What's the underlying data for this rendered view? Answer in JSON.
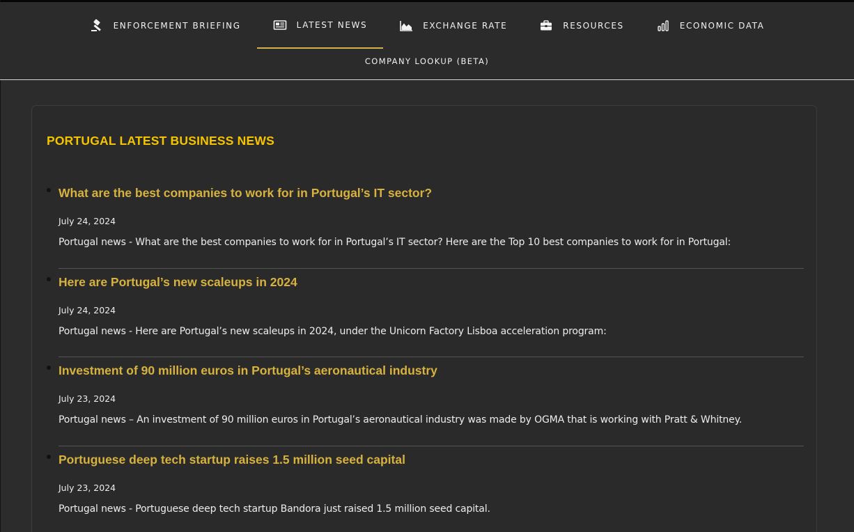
{
  "nav": {
    "items": [
      {
        "label": "ENFORCEMENT BRIEFING",
        "icon": "gavel-icon"
      },
      {
        "label": "LATEST NEWS",
        "icon": "newspaper-icon",
        "active": true
      },
      {
        "label": "EXCHANGE RATE",
        "icon": "area-chart-icon"
      },
      {
        "label": "RESOURCES",
        "icon": "briefcase-icon"
      },
      {
        "label": "ECONOMIC DATA",
        "icon": "bar-chart-icon"
      }
    ],
    "secondary": {
      "label": "COMPANY LOOKUP (BETA)"
    }
  },
  "colors": {
    "accent": "#d4b24c",
    "title_yellow": "#f5c400",
    "link_gold": "#d7b23f",
    "background": "#2c2c2c"
  },
  "main": {
    "section_title": "PORTUGAL LATEST BUSINESS NEWS",
    "news": [
      {
        "title": "What are the best companies to work for in Portugal’s IT sector?",
        "date": "July 24, 2024",
        "excerpt": "Portugal news - What are the best companies to work for in Portugal’s IT sector? Here are the Top 10 best companies to work for in Portugal:"
      },
      {
        "title": "Here are Portugal’s new scaleups in 2024",
        "date": "July 24, 2024",
        "excerpt": "Portugal news - Here are Portugal’s new scaleups in 2024, under the Unicorn Factory Lisboa acceleration program:"
      },
      {
        "title": "Investment of 90 million euros in Portugal’s aeronautical industry",
        "date": "July 23, 2024",
        "excerpt": "Portugal news – An investment of 90 million euros in Portugal’s aeronautical industry was made by OGMA that is working with Pratt & Whitney."
      },
      {
        "title": "Portuguese deep tech startup raises 1.5 million seed capital",
        "date": "July 23, 2024",
        "excerpt": "Portugal news - Portuguese deep tech startup Bandora just raised 1.5 million seed capital."
      }
    ]
  }
}
